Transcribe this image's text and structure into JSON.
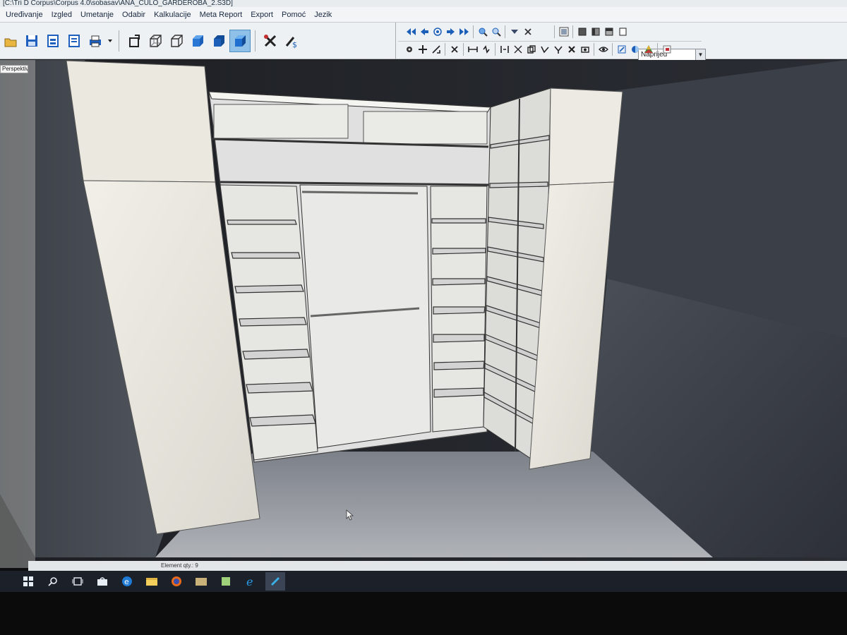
{
  "window": {
    "title": "[C:\\Tri D Corpus\\Corpus 4.0\\sobasav\\ANA_CULO_GARDEROBA_2.S3D]"
  },
  "menu": {
    "items": [
      "Uređivanje",
      "Izgled",
      "Umetanje",
      "Odabir",
      "Kalkulacije",
      "Meta Report",
      "Export",
      "Pomoć",
      "Jezik"
    ]
  },
  "toolbar": {
    "view_select": {
      "value": "Naprijed"
    },
    "left_icons": [
      "open-icon",
      "save-icon",
      "print-preview-icon",
      "report-icon",
      "printer-icon",
      "dropdown-arrow-icon",
      "rotate-object-icon",
      "wireframe-icon",
      "hidden-line-icon",
      "shaded-cube-icon",
      "solid-cube-icon",
      "textured-cube-icon",
      "tools-icon",
      "price-tool-icon"
    ],
    "right_row1_icons": [
      "first-icon",
      "previous-icon",
      "center-icon",
      "next-icon",
      "last-icon",
      "zoom-in-icon",
      "zoom-out-icon",
      "filter-icon",
      "close-x-icon"
    ],
    "right_row1b_icons": [
      "grid-view-icon",
      "view-front-icon",
      "view-side-icon",
      "view-top-icon",
      "view-iso-icon"
    ],
    "right_row2_icons": [
      "gear-icon",
      "move-icon",
      "measure-icon",
      "delete-x-icon",
      "width-icon",
      "height-icon",
      "align-icon",
      "resize-icon",
      "copy-icon",
      "rotate-icon",
      "flip-icon",
      "remove-icon",
      "camera-icon",
      "eye-icon",
      "edit-icon",
      "shade-icon",
      "color-icon",
      "export-icon"
    ]
  },
  "viewport": {
    "tab_label": "Perspektiva"
  },
  "status": {
    "text": "Element qty.: 9"
  },
  "taskbar": {
    "icons": [
      "windows-start-icon",
      "search-icon",
      "task-view-icon",
      "store-icon",
      "edge-icon",
      "file-explorer-icon",
      "firefox-icon",
      "folder-icon",
      "notes-icon",
      "internet-explorer-icon",
      "corpus-app-icon"
    ]
  },
  "colors": {
    "panel": "#eceae2",
    "accent": "#8fc1e8",
    "toolbar_blue": "#1c5fb8"
  }
}
